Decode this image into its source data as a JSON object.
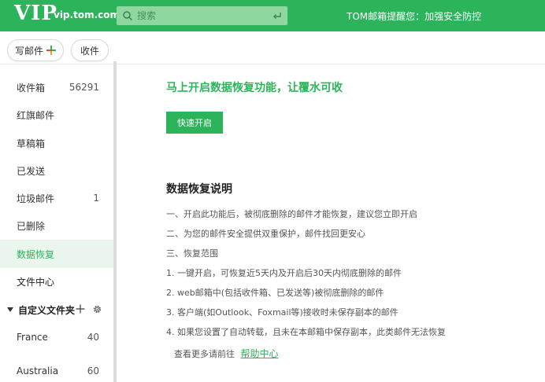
{
  "header": {
    "logo_text": "VIP",
    "domain": "vip.tom.com",
    "search_placeholder": "搜索",
    "notice": "TOM邮箱提醒您：加强安全防控",
    "colors": {
      "brand": "#2cb45a",
      "search_bg": "#8ed89f"
    }
  },
  "actions": {
    "compose_label": "写邮件",
    "receive_label": "收件"
  },
  "sidebar": {
    "items": [
      {
        "label": "收件箱",
        "count": "56291"
      },
      {
        "label": "红旗邮件",
        "count": ""
      },
      {
        "label": "草稿箱",
        "count": ""
      },
      {
        "label": "已发送",
        "count": ""
      },
      {
        "label": "垃圾邮件",
        "count": "1"
      },
      {
        "label": "已删除",
        "count": ""
      },
      {
        "label": "数据恢复",
        "count": "",
        "active": true
      },
      {
        "label": "文件中心",
        "count": ""
      }
    ],
    "custom_folders_label": "自定义文件夹",
    "folders": [
      {
        "label": "France",
        "count": "40"
      },
      {
        "label": "Australia",
        "count": "60"
      }
    ]
  },
  "main": {
    "promo_title": "马上开启数据恢复功能，让覆水可收",
    "quick_button": "快速开启",
    "section_title": "数据恢复说明",
    "lines": [
      "一、开启此功能后，被彻底删除的邮件才能恢复，建议您立即开启",
      "二、为您的邮件安全提供双重保护，邮件找回更安心",
      "三、恢复范围",
      "1. 一键开启，可恢复近5天内及开启后30天内彻底删除的邮件",
      "2. web邮箱中(包括收件箱、已发送等)被彻底删除的邮件",
      "3. 客户端(如Outlook、Foxmail等)接收时未保存副本的邮件",
      "4. 如果您设置了自动转载，且未在本邮箱中保存副本，此类邮件无法恢复"
    ],
    "help_prefix": "查看更多请前往",
    "help_link": "帮助中心"
  }
}
